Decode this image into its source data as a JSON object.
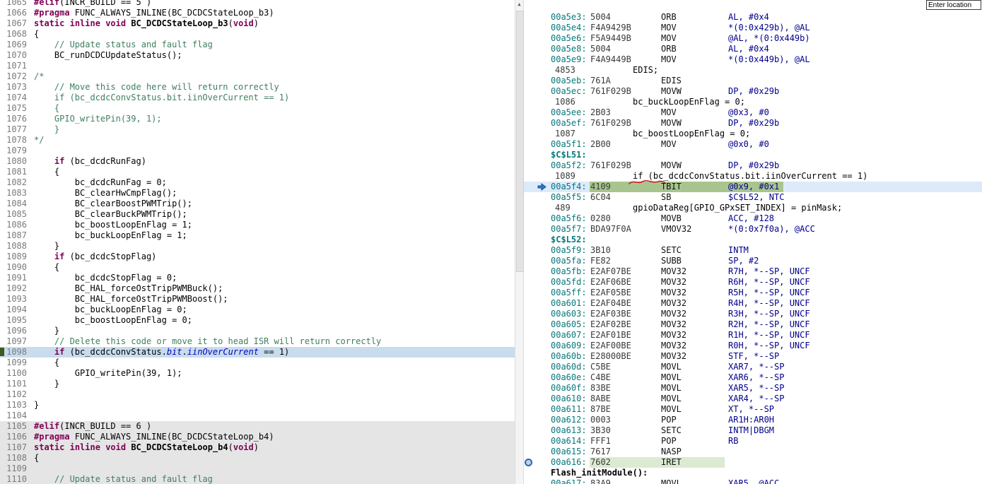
{
  "location_bar": {
    "value": "Enter location"
  },
  "scrollbar": {
    "up_glyph": "▲"
  },
  "colors": {
    "pc_highlight": "#a9c58f",
    "pc_row": "#ddeafa",
    "halt_highlight": "#dcead2",
    "selected_line": "#c8dcee",
    "inactive_block": "#e5e5e5"
  },
  "editor": {
    "lines": [
      {
        "n": 1065,
        "segs": [
          [
            "d",
            "#elif"
          ],
          [
            "p",
            "(INCR_BUILD == 5 )"
          ]
        ]
      },
      {
        "n": 1066,
        "segs": [
          [
            "d",
            "#pragma"
          ],
          [
            "p",
            " FUNC_ALWAYS_INLINE(BC_DCDCStateLoop_b3)"
          ]
        ]
      },
      {
        "n": 1067,
        "segs": [
          [
            "k",
            "static"
          ],
          [
            "p",
            " "
          ],
          [
            "k",
            "inline"
          ],
          [
            "p",
            " "
          ],
          [
            "k",
            "void"
          ],
          [
            "p",
            " "
          ],
          [
            "b",
            "BC_DCDCStateLoop_b3"
          ],
          [
            "p",
            "("
          ],
          [
            "k",
            "void"
          ],
          [
            "p",
            ")"
          ]
        ]
      },
      {
        "n": 1068,
        "segs": [
          [
            "p",
            "{"
          ]
        ]
      },
      {
        "n": 1069,
        "segs": [
          [
            "c",
            "    // Update status and fault flag"
          ]
        ]
      },
      {
        "n": 1070,
        "segs": [
          [
            "p",
            "    BC_runDCDCUpdateStatus();"
          ]
        ]
      },
      {
        "n": 1071,
        "segs": []
      },
      {
        "n": 1072,
        "segs": [
          [
            "c",
            "/*"
          ]
        ]
      },
      {
        "n": 1073,
        "segs": [
          [
            "c",
            "    // Move this code here will return correctly"
          ]
        ]
      },
      {
        "n": 1074,
        "segs": [
          [
            "c",
            "    if (bc_dcdcConvStatus.bit.iinOverCurrent == 1)"
          ]
        ]
      },
      {
        "n": 1075,
        "segs": [
          [
            "c",
            "    {"
          ]
        ]
      },
      {
        "n": 1076,
        "segs": [
          [
            "c",
            "    GPIO_writePin(39, 1);"
          ]
        ]
      },
      {
        "n": 1077,
        "segs": [
          [
            "c",
            "    }"
          ]
        ]
      },
      {
        "n": 1078,
        "segs": [
          [
            "c",
            "*/"
          ]
        ]
      },
      {
        "n": 1079,
        "segs": []
      },
      {
        "n": 1080,
        "segs": [
          [
            "p",
            "    "
          ],
          [
            "k",
            "if"
          ],
          [
            "p",
            " (bc_dcdcRunFag)"
          ]
        ]
      },
      {
        "n": 1081,
        "segs": [
          [
            "p",
            "    {"
          ]
        ]
      },
      {
        "n": 1082,
        "segs": [
          [
            "p",
            "        bc_dcdcRunFag = 0;"
          ]
        ]
      },
      {
        "n": 1083,
        "segs": [
          [
            "p",
            "        BC_clearHwCmpFlag();"
          ]
        ]
      },
      {
        "n": 1084,
        "segs": [
          [
            "p",
            "        BC_clearBoostPWMTrip();"
          ]
        ]
      },
      {
        "n": 1085,
        "segs": [
          [
            "p",
            "        BC_clearBuckPWMTrip();"
          ]
        ]
      },
      {
        "n": 1086,
        "segs": [
          [
            "p",
            "        bc_boostLoopEnFlag = 1;"
          ]
        ]
      },
      {
        "n": 1087,
        "segs": [
          [
            "p",
            "        bc_buckLoopEnFlag = 1;"
          ]
        ]
      },
      {
        "n": 1088,
        "segs": [
          [
            "p",
            "    }"
          ]
        ]
      },
      {
        "n": 1089,
        "segs": [
          [
            "p",
            "    "
          ],
          [
            "k",
            "if"
          ],
          [
            "p",
            " (bc_dcdcStopFlag)"
          ]
        ]
      },
      {
        "n": 1090,
        "segs": [
          [
            "p",
            "    {"
          ]
        ]
      },
      {
        "n": 1091,
        "segs": [
          [
            "p",
            "        bc_dcdcStopFlag = 0;"
          ]
        ]
      },
      {
        "n": 1092,
        "segs": [
          [
            "p",
            "        BC_HAL_forceOstTripPWMBuck();"
          ]
        ]
      },
      {
        "n": 1093,
        "segs": [
          [
            "p",
            "        BC_HAL_forceOstTripPWMBoost();"
          ]
        ]
      },
      {
        "n": 1094,
        "segs": [
          [
            "p",
            "        bc_buckLoopEnFlag = 0;"
          ]
        ]
      },
      {
        "n": 1095,
        "segs": [
          [
            "p",
            "        bc_boostLoopEnFlag = 0;"
          ]
        ]
      },
      {
        "n": 1096,
        "segs": [
          [
            "p",
            "    }"
          ]
        ]
      },
      {
        "n": 1097,
        "segs": [
          [
            "c",
            "    // Delete this code or move it to head ISR will return correctly"
          ]
        ]
      },
      {
        "n": 1098,
        "style": "sel",
        "marker": true,
        "segs": [
          [
            "p",
            "    "
          ],
          [
            "k",
            "if"
          ],
          [
            "p",
            " (bc_dcdcConvStatus."
          ],
          [
            "f",
            "bit"
          ],
          [
            "p",
            "."
          ],
          [
            "f",
            "iinOverCurrent"
          ],
          [
            "p",
            " == 1)"
          ]
        ]
      },
      {
        "n": 1099,
        "segs": [
          [
            "p",
            "    {"
          ]
        ]
      },
      {
        "n": 1100,
        "segs": [
          [
            "p",
            "        GPIO_writePin(39, 1);"
          ]
        ]
      },
      {
        "n": 1101,
        "segs": [
          [
            "p",
            "    }"
          ]
        ]
      },
      {
        "n": 1102,
        "segs": []
      },
      {
        "n": 1103,
        "segs": [
          [
            "p",
            "}"
          ]
        ]
      },
      {
        "n": 1104,
        "segs": []
      },
      {
        "n": 1105,
        "style": "inactive",
        "segs": [
          [
            "d",
            "#elif"
          ],
          [
            "p",
            "(INCR_BUILD == 6 )"
          ]
        ]
      },
      {
        "n": 1106,
        "style": "inactive",
        "segs": [
          [
            "d",
            "#pragma"
          ],
          [
            "p",
            " FUNC_ALWAYS_INLINE(BC_DCDCStateLoop_b4)"
          ]
        ]
      },
      {
        "n": 1107,
        "style": "inactive",
        "segs": [
          [
            "k",
            "static"
          ],
          [
            "p",
            " "
          ],
          [
            "k",
            "inline"
          ],
          [
            "p",
            " "
          ],
          [
            "k",
            "void"
          ],
          [
            "p",
            " "
          ],
          [
            "b",
            "BC_DCDCStateLoop_b4"
          ],
          [
            "p",
            "("
          ],
          [
            "k",
            "void"
          ],
          [
            "p",
            ")"
          ]
        ]
      },
      {
        "n": 1108,
        "style": "inactive",
        "segs": [
          [
            "p",
            "{"
          ]
        ]
      },
      {
        "n": 1109,
        "style": "inactive",
        "segs": []
      },
      {
        "n": 1110,
        "style": "inactive",
        "segs": [
          [
            "c",
            "    // Update status and fault flag"
          ]
        ]
      }
    ]
  },
  "disassembly": {
    "rows": [
      {
        "t": "i",
        "addr": "00a5e3:",
        "op": "5004",
        "mn": "ORB",
        "args": "AL, #0x4"
      },
      {
        "t": "i",
        "addr": "00a5e4:",
        "op": "F4A9429B",
        "mn": "MOV",
        "args": "*(0:0x429b), @AL"
      },
      {
        "t": "i",
        "addr": "00a5e6:",
        "op": "F5A9449B",
        "mn": "MOV",
        "args": "@AL, *(0:0x449b)"
      },
      {
        "t": "i",
        "addr": "00a5e8:",
        "op": "5004",
        "mn": "ORB",
        "args": "AL, #0x4"
      },
      {
        "t": "i",
        "addr": "00a5e9:",
        "op": "F4A9449B",
        "mn": "MOV",
        "args": "*(0:0x449b), @AL"
      },
      {
        "t": "s",
        "n": "4853",
        "src": "EDIS;"
      },
      {
        "t": "i",
        "addr": "00a5eb:",
        "op": "761A",
        "mn": "EDIS",
        "args": ""
      },
      {
        "t": "i",
        "addr": "00a5ec:",
        "op": "761F029B",
        "mn": "MOVW",
        "args": "DP, #0x29b"
      },
      {
        "t": "s",
        "n": "1086",
        "src": "bc_buckLoopEnFlag = 0;"
      },
      {
        "t": "i",
        "addr": "00a5ee:",
        "op": "2B03",
        "mn": "MOV",
        "args": "@0x3, #0"
      },
      {
        "t": "i",
        "addr": "00a5ef:",
        "op": "761F029B",
        "mn": "MOVW",
        "args": "DP, #0x29b"
      },
      {
        "t": "s",
        "n": "1087",
        "src": "bc_boostLoopEnFlag = 0;"
      },
      {
        "t": "i",
        "addr": "00a5f1:",
        "op": "2B00",
        "mn": "MOV",
        "args": "@0x0, #0"
      },
      {
        "t": "l",
        "label": "$C$L51:"
      },
      {
        "t": "i",
        "addr": "00a5f2:",
        "op": "761F029B",
        "mn": "MOVW",
        "args": "DP, #0x29b"
      },
      {
        "t": "s",
        "n": "1089",
        "src": "if (bc_dcdcConvStatus.bit.iinOverCurrent == 1)"
      },
      {
        "t": "i",
        "addr": "00a5f4:",
        "op": "4109",
        "mn": "TBIT",
        "args": "@0x9, #0x1",
        "hl": "pc",
        "icon": "arrow"
      },
      {
        "t": "i",
        "addr": "00a5f5:",
        "op": "6C04",
        "mn": "SB",
        "args": "$C$L52, NTC"
      },
      {
        "t": "s",
        "n": "489",
        "src": "gpioDataReg[GPIO_GPxSET_INDEX] = pinMask;"
      },
      {
        "t": "i",
        "addr": "00a5f6:",
        "op": "0280",
        "mn": "MOVB",
        "args": "ACC, #128"
      },
      {
        "t": "i",
        "addr": "00a5f7:",
        "op": "BDA97F0A",
        "mn": "VMOV32",
        "args": "*(0:0x7f0a), @ACC"
      },
      {
        "t": "l",
        "label": "$C$L52:"
      },
      {
        "t": "i",
        "addr": "00a5f9:",
        "op": "3B10",
        "mn": "SETC",
        "args": "INTM"
      },
      {
        "t": "i",
        "addr": "00a5fa:",
        "op": "FE82",
        "mn": "SUBB",
        "args": "SP, #2"
      },
      {
        "t": "i",
        "addr": "00a5fb:",
        "op": "E2AF07BE",
        "mn": "MOV32",
        "args": "R7H, *--SP, UNCF"
      },
      {
        "t": "i",
        "addr": "00a5fd:",
        "op": "E2AF06BE",
        "mn": "MOV32",
        "args": "R6H, *--SP, UNCF"
      },
      {
        "t": "i",
        "addr": "00a5ff:",
        "op": "E2AF05BE",
        "mn": "MOV32",
        "args": "R5H, *--SP, UNCF"
      },
      {
        "t": "i",
        "addr": "00a601:",
        "op": "E2AF04BE",
        "mn": "MOV32",
        "args": "R4H, *--SP, UNCF"
      },
      {
        "t": "i",
        "addr": "00a603:",
        "op": "E2AF03BE",
        "mn": "MOV32",
        "args": "R3H, *--SP, UNCF"
      },
      {
        "t": "i",
        "addr": "00a605:",
        "op": "E2AF02BE",
        "mn": "MOV32",
        "args": "R2H, *--SP, UNCF"
      },
      {
        "t": "i",
        "addr": "00a607:",
        "op": "E2AF01BE",
        "mn": "MOV32",
        "args": "R1H, *--SP, UNCF"
      },
      {
        "t": "i",
        "addr": "00a609:",
        "op": "E2AF00BE",
        "mn": "MOV32",
        "args": "R0H, *--SP, UNCF"
      },
      {
        "t": "i",
        "addr": "00a60b:",
        "op": "E28000BE",
        "mn": "MOV32",
        "args": "STF, *--SP"
      },
      {
        "t": "i",
        "addr": "00a60d:",
        "op": "C5BE",
        "mn": "MOVL",
        "args": "XAR7, *--SP"
      },
      {
        "t": "i",
        "addr": "00a60e:",
        "op": "C4BE",
        "mn": "MOVL",
        "args": "XAR6, *--SP"
      },
      {
        "t": "i",
        "addr": "00a60f:",
        "op": "83BE",
        "mn": "MOVL",
        "args": "XAR5, *--SP"
      },
      {
        "t": "i",
        "addr": "00a610:",
        "op": "8ABE",
        "mn": "MOVL",
        "args": "XAR4, *--SP"
      },
      {
        "t": "i",
        "addr": "00a611:",
        "op": "87BE",
        "mn": "MOVL",
        "args": "XT, *--SP"
      },
      {
        "t": "i",
        "addr": "00a612:",
        "op": "0003",
        "mn": "POP",
        "args": "AR1H:AR0H"
      },
      {
        "t": "i",
        "addr": "00a613:",
        "op": "3B30",
        "mn": "SETC",
        "args": "INTM|DBGM"
      },
      {
        "t": "i",
        "addr": "00a614:",
        "op": "FFF1",
        "mn": "POP",
        "args": "RB"
      },
      {
        "t": "i",
        "addr": "00a615:",
        "op": "7617",
        "mn": "NASP",
        "args": ""
      },
      {
        "t": "i",
        "addr": "00a616:",
        "op": "7602",
        "mn": "IRET",
        "args": "",
        "hl": "soft",
        "icon": "circle"
      },
      {
        "t": "f",
        "label": "Flash_initModule():"
      },
      {
        "t": "i",
        "addr": "00a617:",
        "op": "83A9",
        "mn": "MOVL",
        "args": "XAR5, @ACC"
      }
    ],
    "annotation": {
      "type": "red-squiggle",
      "note": "hand-drawn red underline beneath 'bc_dcdc' in interleaved source line 1089"
    }
  }
}
